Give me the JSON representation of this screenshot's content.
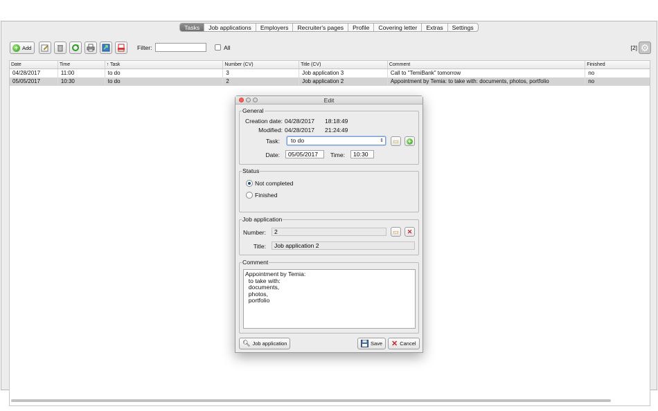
{
  "tabs": [
    {
      "label": "Tasks",
      "active": true
    },
    {
      "label": "Job applications"
    },
    {
      "label": "Employers"
    },
    {
      "label": "Recruiter's pages"
    },
    {
      "label": "Profile"
    },
    {
      "label": "Covering letter"
    },
    {
      "label": "Extras"
    },
    {
      "label": "Settings"
    }
  ],
  "toolbar": {
    "add_label": "Add",
    "filter_label": "Filter:",
    "filter_value": "",
    "all_label": "All",
    "count_label": "[2]"
  },
  "table": {
    "columns": [
      "Date",
      "Time",
      "↑ Task",
      "Number (CV)",
      "Title (CV)",
      "Comment",
      "Finished"
    ],
    "rows": [
      [
        "04/28/2017",
        "11:00",
        "to do",
        "3",
        "Job application 3",
        "Call to \"TemiBank\" tomorrow",
        "no"
      ],
      [
        "05/05/2017",
        "10:30",
        "to do",
        "2",
        "Job application 2",
        "Appointment by Temia:    to take with:   documents,    photos,    portfolio",
        "no"
      ]
    ],
    "selected_row": 1
  },
  "dialog": {
    "title": "Edit",
    "general": {
      "legend": "General",
      "creation_label": "Creation date:",
      "creation_date": "04/28/2017",
      "creation_time": "18:18:49",
      "modified_label": "Modified:",
      "modified_date": "04/28/2017",
      "modified_time": "21:24:49",
      "task_label": "Task:",
      "task_value": "to do",
      "date_label": "Date:",
      "date_value": "05/05/2017",
      "time_label": "Time:",
      "time_value": "10:30"
    },
    "status": {
      "legend": "Status",
      "not_completed_label": "Not completed",
      "finished_label": "Finished",
      "selected": "not_completed"
    },
    "job_application": {
      "legend": "Job application",
      "number_label": "Number:",
      "number_value": "2",
      "title_label": "Title:",
      "title_value": "Job application 2"
    },
    "comment": {
      "legend": "Comment",
      "text": "Appointment by Temia:\n  to take with:\n  documents,\n  photos,\n  portfolio"
    },
    "buttons": {
      "job_application_label": "Job application",
      "save_label": "Save",
      "cancel_label": "Cancel"
    }
  },
  "colors": {
    "active_tab": "#7a7a7a",
    "selected_row": "#d4d4d4",
    "window_bg": "#ececec"
  }
}
